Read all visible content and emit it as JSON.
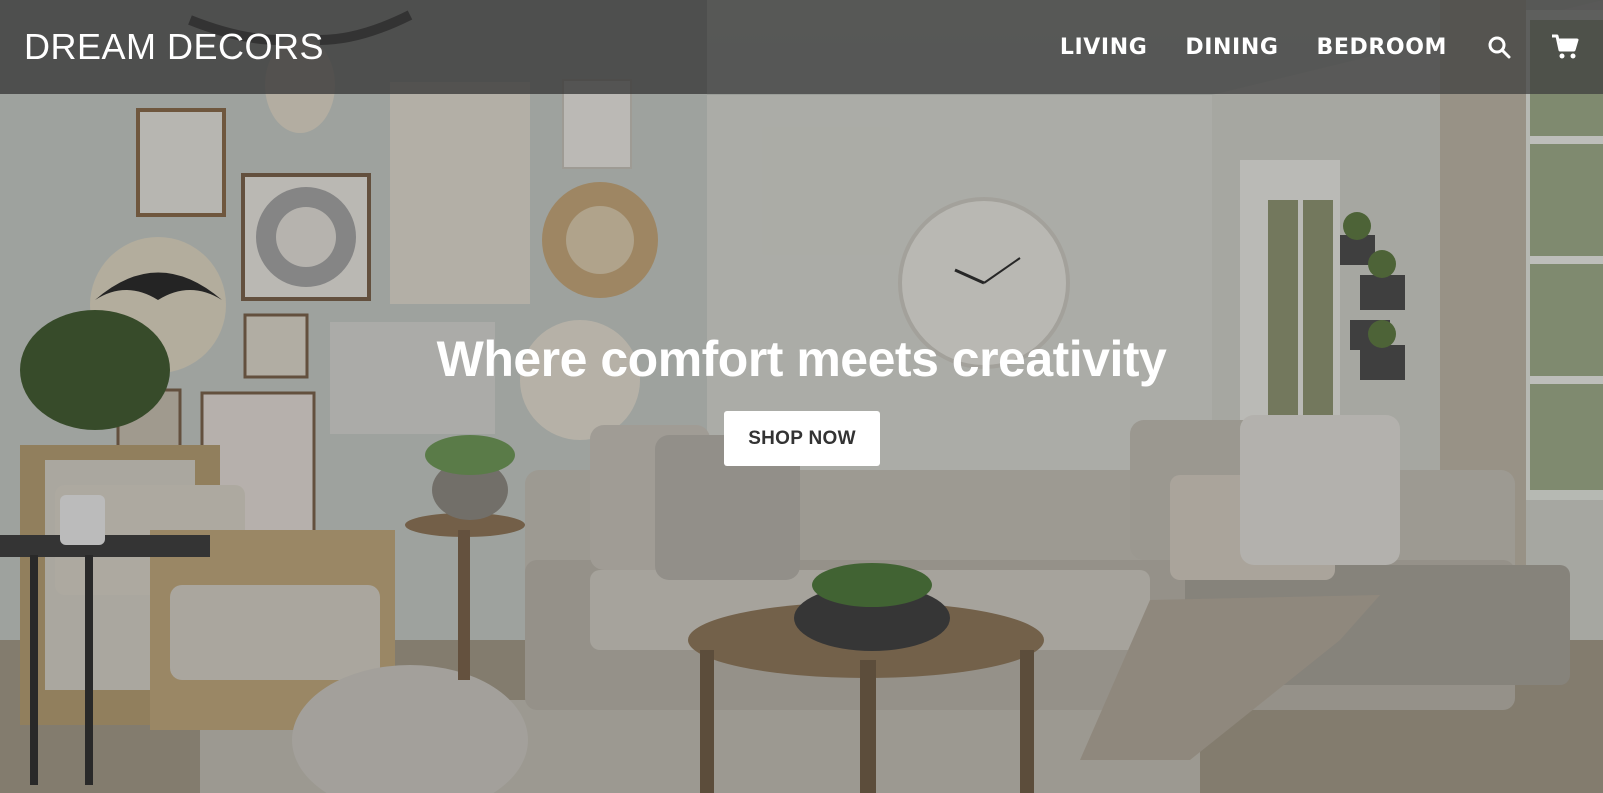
{
  "header": {
    "brand": "DREAM DECORS",
    "nav": [
      {
        "label": "LIVING"
      },
      {
        "label": "DINING"
      },
      {
        "label": "BEDROOM"
      }
    ],
    "icons": [
      "search-icon",
      "cart-icon"
    ]
  },
  "hero": {
    "headline": "Where comfort meets creativity",
    "cta_label": "SHOP NOW",
    "image": "living-room-scene"
  },
  "colors": {
    "header_bg": "#3c3c3c",
    "text": "#ffffff",
    "button_bg": "#ffffff",
    "button_text": "#333333"
  }
}
